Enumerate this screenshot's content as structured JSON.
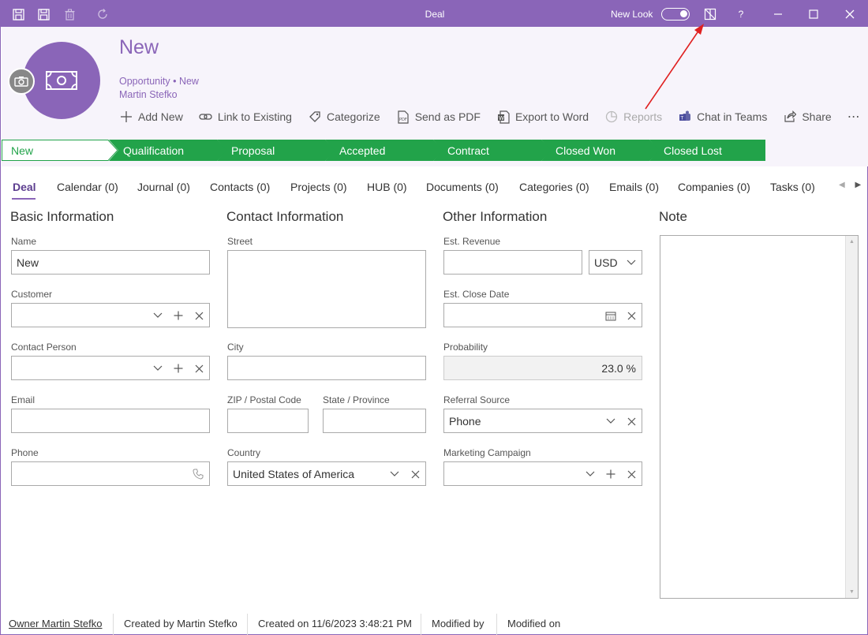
{
  "window": {
    "title": "Deal",
    "new_look_label": "New Look",
    "help_label": "?"
  },
  "record": {
    "title": "New",
    "subtitle": "Opportunity • New",
    "owner_name": "Martin Stefko"
  },
  "actions": [
    {
      "label": "Add New",
      "icon": "plus-icon",
      "enabled": true
    },
    {
      "label": "Link to Existing",
      "icon": "link-icon",
      "enabled": true
    },
    {
      "label": "Categorize",
      "icon": "tag-icon",
      "enabled": true
    },
    {
      "label": "Send as PDF",
      "icon": "pdf-icon",
      "enabled": true
    },
    {
      "label": "Export to Word",
      "icon": "word-icon",
      "enabled": true
    },
    {
      "label": "Reports",
      "icon": "pie-chart-icon",
      "enabled": false
    },
    {
      "label": "Chat in Teams",
      "icon": "teams-icon",
      "enabled": true
    },
    {
      "label": "Share",
      "icon": "share-icon",
      "enabled": true
    },
    {
      "label": "⋯",
      "icon": "more-icon",
      "enabled": true
    }
  ],
  "pipeline": [
    {
      "label": "New",
      "active": true
    },
    {
      "label": "Qualification",
      "active": false
    },
    {
      "label": "Proposal",
      "active": false
    },
    {
      "label": "Accepted",
      "active": false
    },
    {
      "label": "Contract",
      "active": false
    },
    {
      "label": "Closed Won",
      "active": false
    },
    {
      "label": "Closed Lost",
      "active": false
    }
  ],
  "tabs": [
    {
      "label": "Deal"
    },
    {
      "label": "Calendar (0)"
    },
    {
      "label": "Journal (0)"
    },
    {
      "label": "Contacts (0)"
    },
    {
      "label": "Projects (0)"
    },
    {
      "label": "HUB (0)"
    },
    {
      "label": "Documents (0)"
    },
    {
      "label": "Categories (0)"
    },
    {
      "label": "Emails (0)"
    },
    {
      "label": "Companies (0)"
    },
    {
      "label": "Tasks (0)"
    }
  ],
  "basic": {
    "title": "Basic Information",
    "name_label": "Name",
    "name_value": "New",
    "customer_label": "Customer",
    "customer_value": "",
    "contact_label": "Contact Person",
    "contact_value": "",
    "email_label": "Email",
    "email_value": "",
    "phone_label": "Phone",
    "phone_value": ""
  },
  "contact": {
    "title": "Contact Information",
    "street_label": "Street",
    "city_label": "City",
    "zip_label": "ZIP / Postal Code",
    "state_label": "State / Province",
    "country_label": "Country",
    "country_value": "United States of America"
  },
  "other": {
    "title": "Other Information",
    "revenue_label": "Est. Revenue",
    "revenue_value": "",
    "currency_value": "USD",
    "close_date_label": "Est. Close Date",
    "probability_label": "Probability",
    "probability_value": "23.0 %",
    "referral_label": "Referral Source",
    "referral_value": "Phone",
    "campaign_label": "Marketing Campaign",
    "campaign_value": ""
  },
  "note": {
    "title": "Note"
  },
  "footer": {
    "owner": "Owner Martin Stefko",
    "created_by": "Created by Martin Stefko",
    "created_on": "Created on 11/6/2023 3:48:21 PM",
    "modified_by": "Modified by",
    "modified_on": "Modified on"
  },
  "colors": {
    "accent": "#8a65b8",
    "pipeline_green": "#22a34a",
    "header_bg": "#f7f4fb"
  }
}
